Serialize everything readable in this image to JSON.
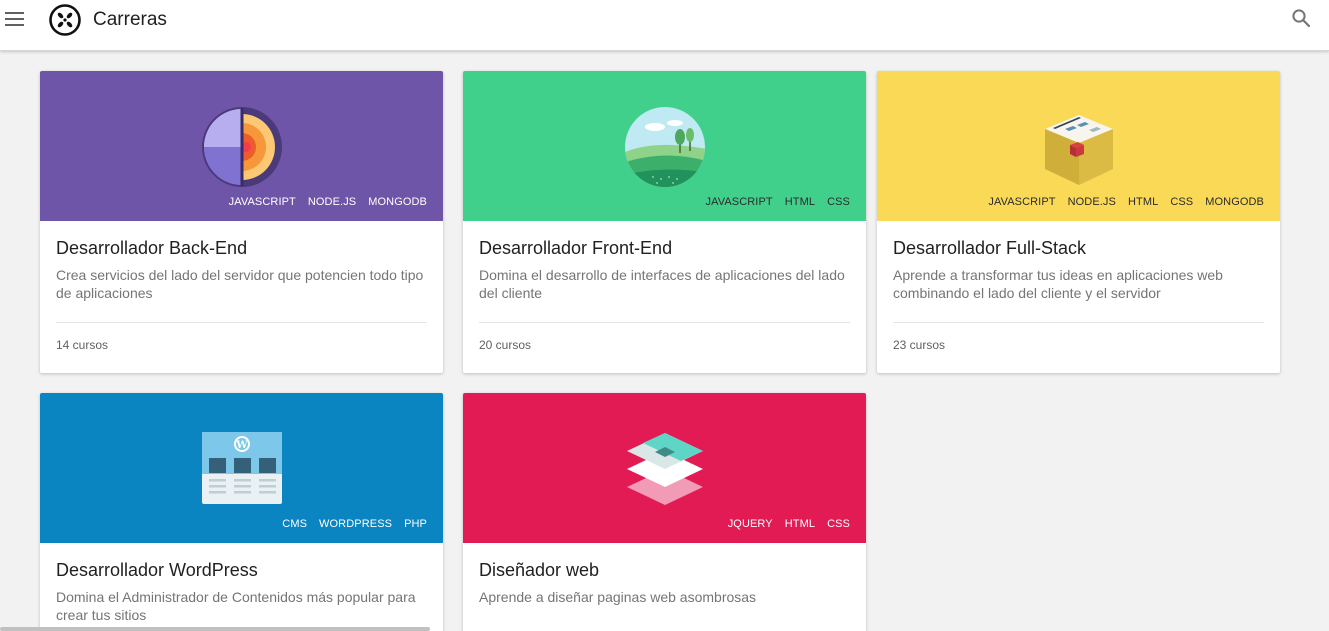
{
  "app": {
    "title": "Carreras"
  },
  "icons": {
    "menu": "hamburger-icon",
    "logo": "brand-logo-icon",
    "search": "search-icon"
  },
  "cards": [
    {
      "title": "Desarrollador Back-End",
      "description": "Crea servicios del lado del servidor que potencien todo tipo de aplicaciones",
      "count": "14 cursos",
      "tags": [
        "JAVASCRIPT",
        "NODE.JS",
        "MONGODB"
      ],
      "color": "#6f55a8"
    },
    {
      "title": "Desarrollador Front-End",
      "description": "Domina el desarrollo de interfaces de aplicaciones del lado del cliente",
      "count": "20 cursos",
      "tags": [
        "JAVASCRIPT",
        "HTML",
        "CSS"
      ],
      "color": "#41d08c"
    },
    {
      "title": "Desarrollador Full-Stack",
      "description": "Aprende a transformar tus ideas en aplicaciones web combinando el lado del cliente y el servidor",
      "count": "23 cursos",
      "tags": [
        "JAVASCRIPT",
        "NODE.JS",
        "HTML",
        "CSS",
        "MONGODB"
      ],
      "color": "#fad957"
    },
    {
      "title": "Desarrollador WordPress",
      "description": "Domina el Administrador de Contenidos más popular para crear tus sitios",
      "tags": [
        "CMS",
        "WORDPRESS",
        "PHP"
      ],
      "color": "#0a85c1"
    },
    {
      "title": "Diseñador web",
      "description": "Aprende a diseñar paginas web asombrosas",
      "tags": [
        "JQUERY",
        "HTML",
        "CSS"
      ],
      "color": "#e31b54"
    }
  ]
}
